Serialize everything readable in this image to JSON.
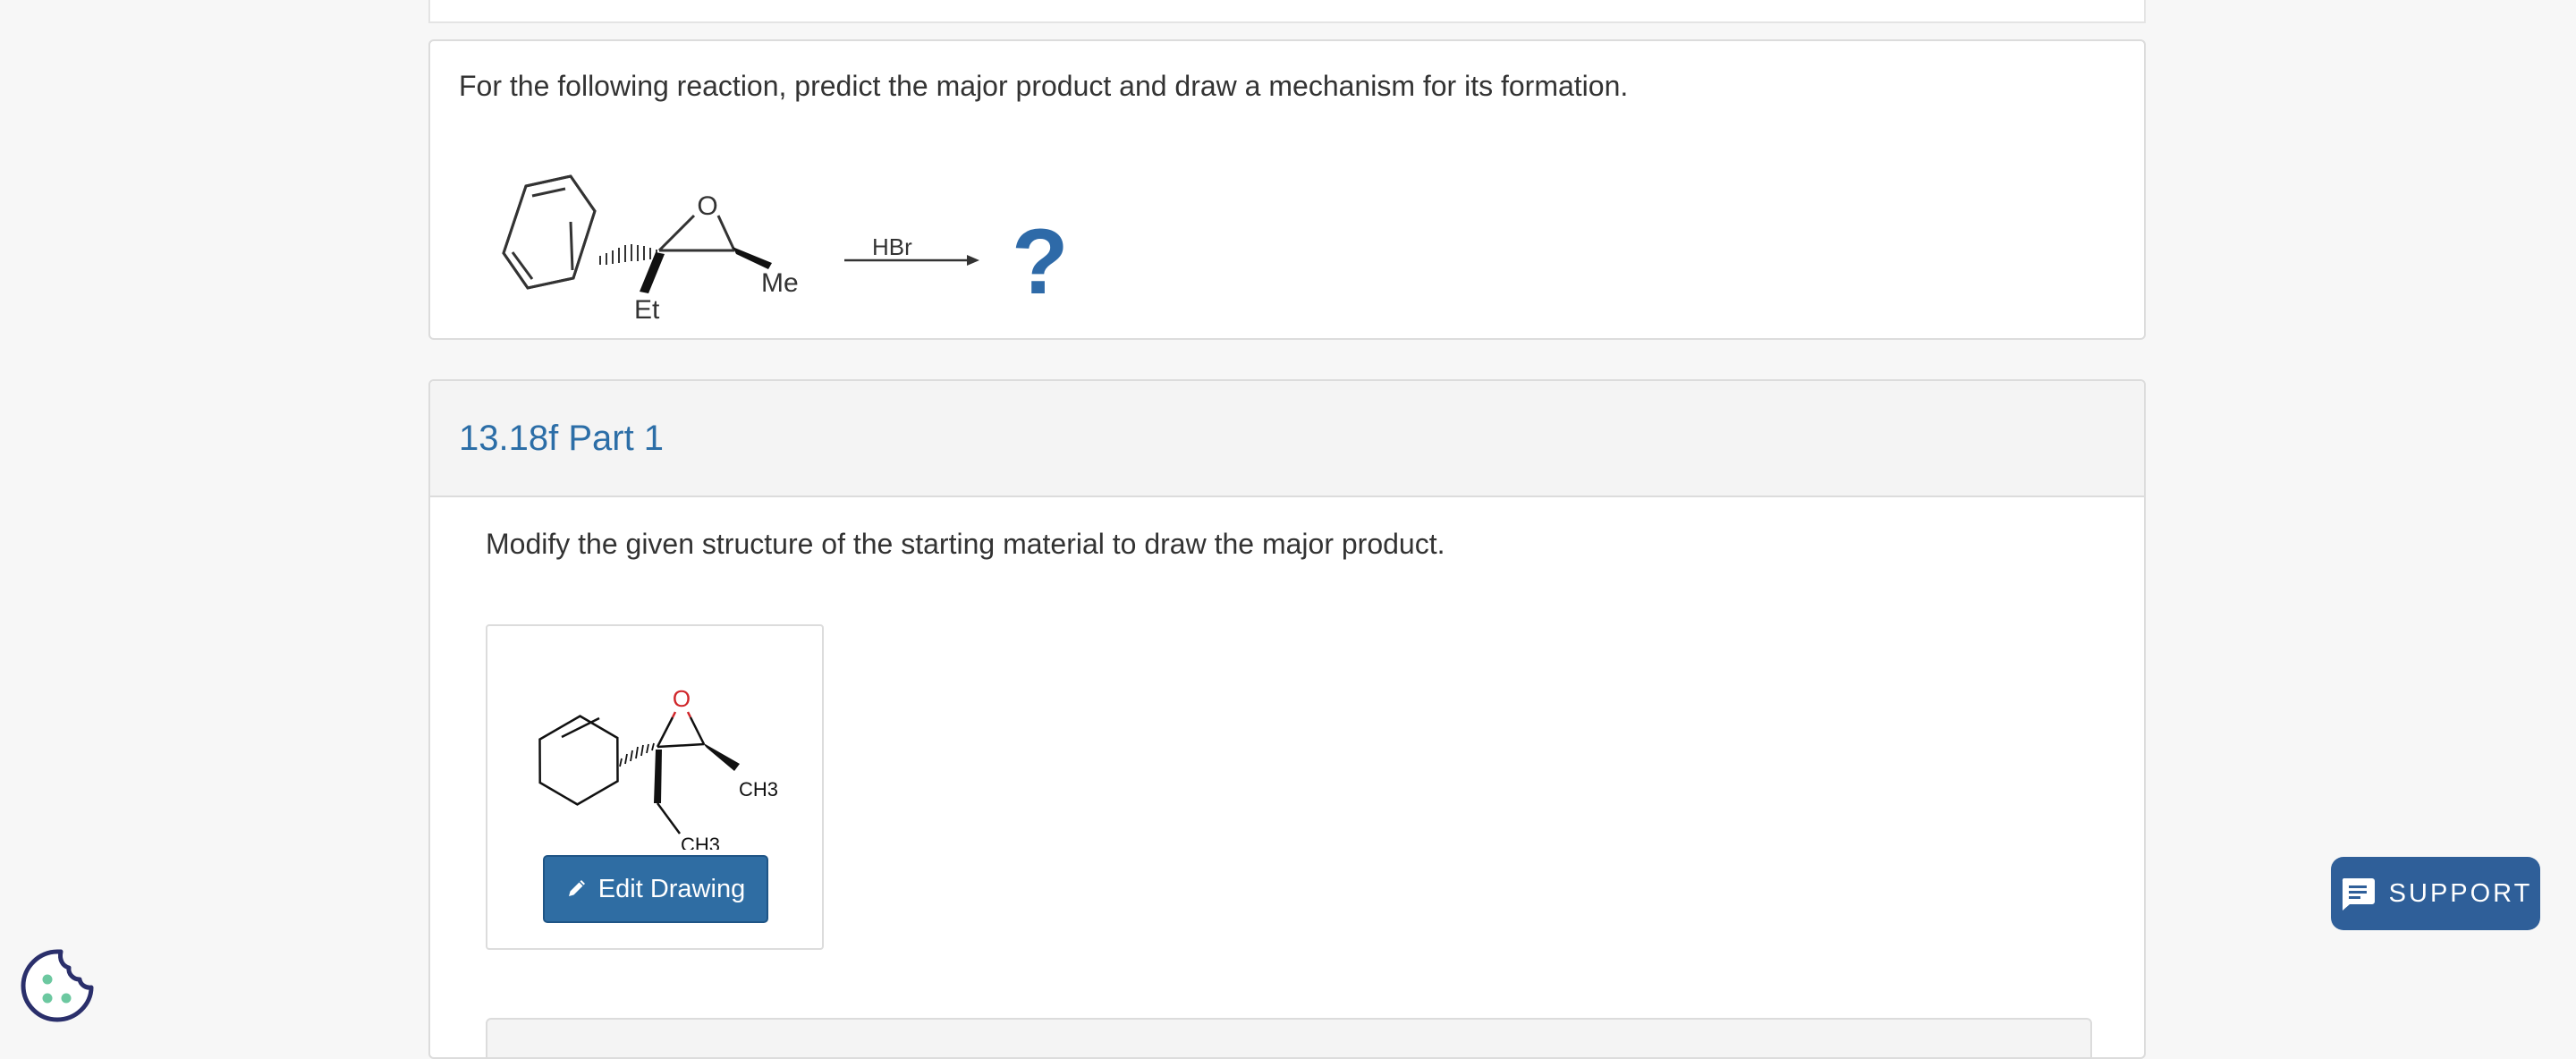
{
  "question": {
    "text": "For the following reaction, predict the major product and draw a mechanism for its formation.",
    "reagent": "HBr",
    "product_placeholder": "?",
    "substituent_ethyl": "Et",
    "substituent_methyl": "Me",
    "oxygen_label": "O"
  },
  "part": {
    "title": "13.18f Part 1",
    "instruction": "Modify the given structure of the starting material to draw the major product.",
    "drawing": {
      "oxygen_label": "O",
      "methyl_label_1": "CH3",
      "methyl_label_2": "CH3"
    },
    "edit_button_label": "Edit Drawing"
  },
  "support": {
    "label": "SUPPORT"
  },
  "colors": {
    "accent": "#2f6da3",
    "title_blue": "#2c6ea7",
    "question_mark": "#2e6aa8",
    "support_bg": "#2f5f99",
    "cookie_outline": "#2a2f6b",
    "cookie_dots": "#6cc8a0",
    "oxygen_red": "#d0262a"
  },
  "icons": {
    "edit": "pencil-icon",
    "support": "chat-message-icon",
    "cookie": "cookie-icon"
  }
}
